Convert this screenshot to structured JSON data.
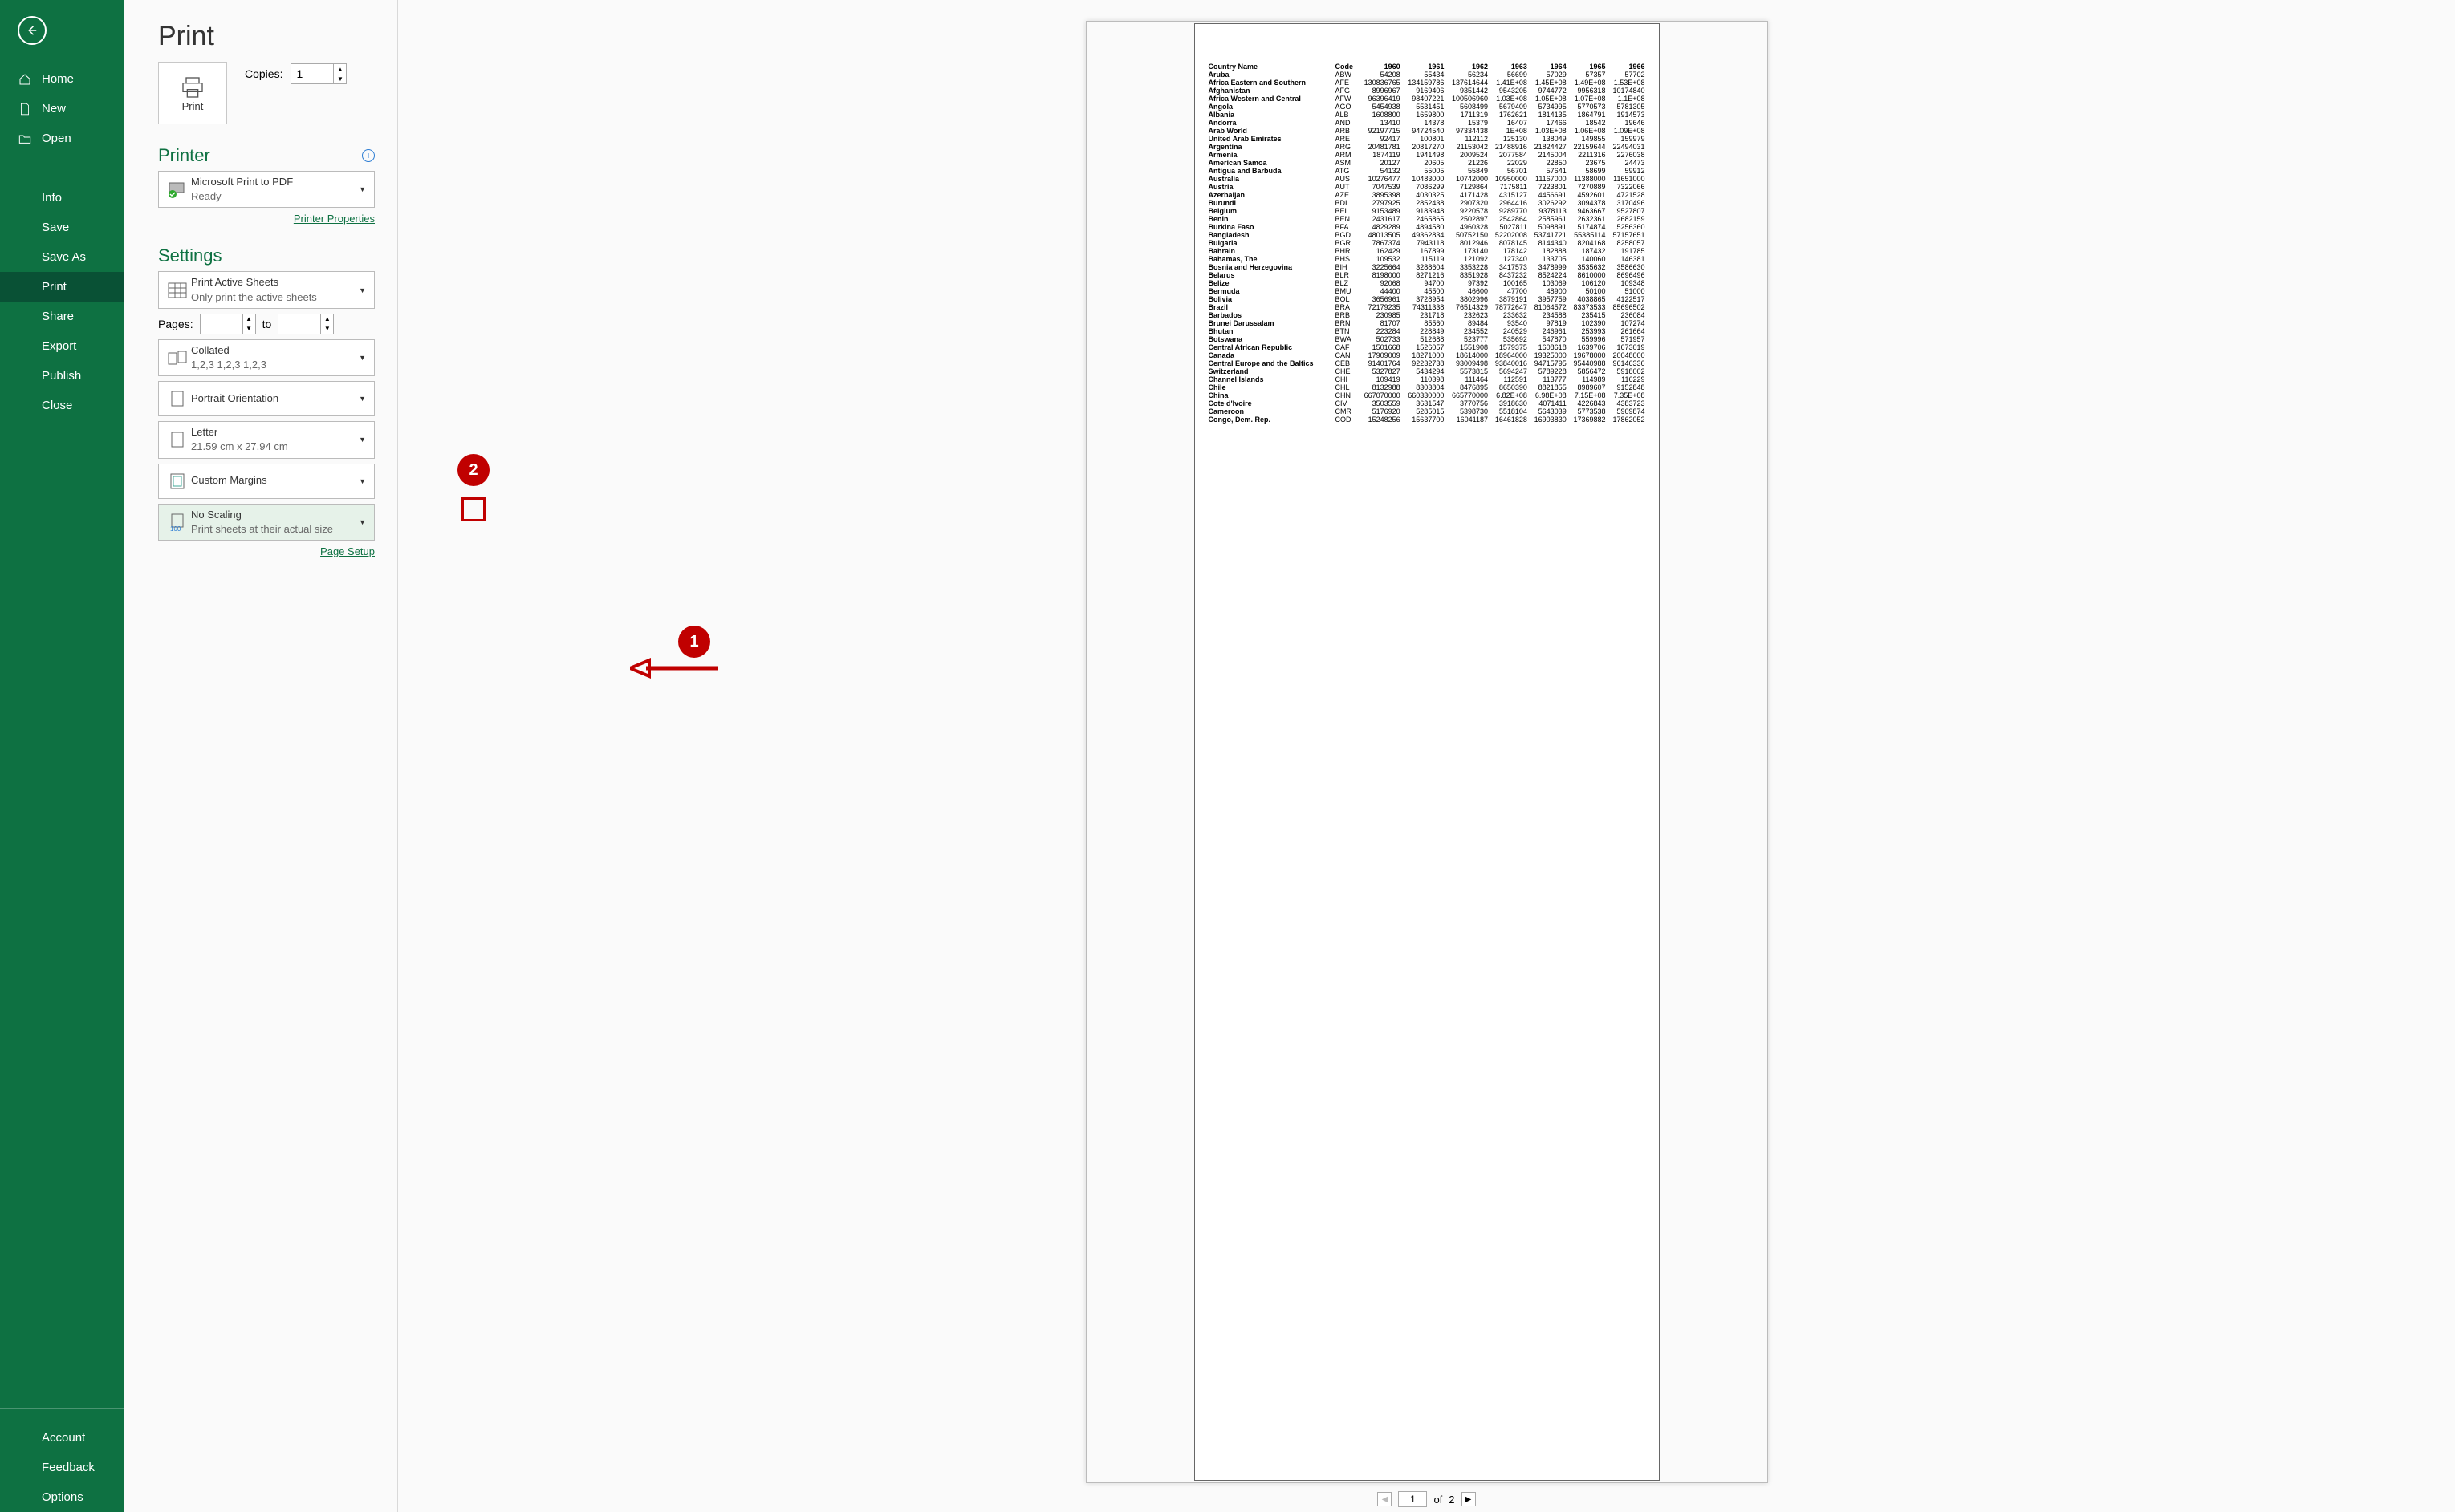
{
  "title": "Print",
  "nav": {
    "home": "Home",
    "new": "New",
    "open": "Open",
    "info": "Info",
    "save": "Save",
    "saveas": "Save As",
    "print": "Print",
    "share": "Share",
    "export": "Export",
    "publish": "Publish",
    "close": "Close",
    "account": "Account",
    "feedback": "Feedback",
    "options": "Options"
  },
  "print_btn": "Print",
  "copies": {
    "label": "Copies:",
    "value": "1"
  },
  "printer": {
    "heading": "Printer",
    "name": "Microsoft Print to PDF",
    "status": "Ready",
    "props_link": "Printer Properties"
  },
  "settings": {
    "heading": "Settings",
    "active": {
      "t": "Print Active Sheets",
      "s": "Only print the active sheets"
    },
    "pages": {
      "label": "Pages:",
      "to": "to"
    },
    "collate": {
      "t": "Collated",
      "s": "1,2,3    1,2,3    1,2,3"
    },
    "orient": {
      "t": "Portrait Orientation"
    },
    "paper": {
      "t": "Letter",
      "s": "21.59 cm x 27.94 cm"
    },
    "margins": {
      "t": "Custom Margins"
    },
    "scaling": {
      "t": "No Scaling",
      "s": "Print sheets at their actual size"
    },
    "page_setup": "Page Setup"
  },
  "pager": {
    "current": "1",
    "of": "of",
    "total": "2"
  },
  "table": {
    "headers": [
      "Country Name",
      "Code",
      "1960",
      "1961",
      "1962",
      "1963",
      "1964",
      "1965",
      "1966"
    ],
    "rows": [
      [
        "Aruba",
        "ABW",
        "54208",
        "55434",
        "56234",
        "56699",
        "57029",
        "57357",
        "57702"
      ],
      [
        "Africa Eastern and Southern",
        "AFE",
        "130836765",
        "134159786",
        "137614644",
        "1.41E+08",
        "1.45E+08",
        "1.49E+08",
        "1.53E+08"
      ],
      [
        "Afghanistan",
        "AFG",
        "8996967",
        "9169406",
        "9351442",
        "9543205",
        "9744772",
        "9956318",
        "10174840"
      ],
      [
        "Africa Western and Central",
        "AFW",
        "96396419",
        "98407221",
        "100506960",
        "1.03E+08",
        "1.05E+08",
        "1.07E+08",
        "1.1E+08"
      ],
      [
        "Angola",
        "AGO",
        "5454938",
        "5531451",
        "5608499",
        "5679409",
        "5734995",
        "5770573",
        "5781305"
      ],
      [
        "Albania",
        "ALB",
        "1608800",
        "1659800",
        "1711319",
        "1762621",
        "1814135",
        "1864791",
        "1914573"
      ],
      [
        "Andorra",
        "AND",
        "13410",
        "14378",
        "15379",
        "16407",
        "17466",
        "18542",
        "19646"
      ],
      [
        "Arab World",
        "ARB",
        "92197715",
        "94724540",
        "97334438",
        "1E+08",
        "1.03E+08",
        "1.06E+08",
        "1.09E+08"
      ],
      [
        "United Arab Emirates",
        "ARE",
        "92417",
        "100801",
        "112112",
        "125130",
        "138049",
        "149855",
        "159979"
      ],
      [
        "Argentina",
        "ARG",
        "20481781",
        "20817270",
        "21153042",
        "21488916",
        "21824427",
        "22159644",
        "22494031"
      ],
      [
        "Armenia",
        "ARM",
        "1874119",
        "1941498",
        "2009524",
        "2077584",
        "2145004",
        "2211316",
        "2276038"
      ],
      [
        "American Samoa",
        "ASM",
        "20127",
        "20605",
        "21226",
        "22029",
        "22850",
        "23675",
        "24473"
      ],
      [
        "Antigua and Barbuda",
        "ATG",
        "54132",
        "55005",
        "55849",
        "56701",
        "57641",
        "58699",
        "59912"
      ],
      [
        "Australia",
        "AUS",
        "10276477",
        "10483000",
        "10742000",
        "10950000",
        "11167000",
        "11388000",
        "11651000"
      ],
      [
        "Austria",
        "AUT",
        "7047539",
        "7086299",
        "7129864",
        "7175811",
        "7223801",
        "7270889",
        "7322066"
      ],
      [
        "Azerbaijan",
        "AZE",
        "3895398",
        "4030325",
        "4171428",
        "4315127",
        "4456691",
        "4592601",
        "4721528"
      ],
      [
        "Burundi",
        "BDI",
        "2797925",
        "2852438",
        "2907320",
        "2964416",
        "3026292",
        "3094378",
        "3170496"
      ],
      [
        "Belgium",
        "BEL",
        "9153489",
        "9183948",
        "9220578",
        "9289770",
        "9378113",
        "9463667",
        "9527807"
      ],
      [
        "Benin",
        "BEN",
        "2431617",
        "2465865",
        "2502897",
        "2542864",
        "2585961",
        "2632361",
        "2682159"
      ],
      [
        "Burkina Faso",
        "BFA",
        "4829289",
        "4894580",
        "4960328",
        "5027811",
        "5098891",
        "5174874",
        "5256360"
      ],
      [
        "Bangladesh",
        "BGD",
        "48013505",
        "49362834",
        "50752150",
        "52202008",
        "53741721",
        "55385114",
        "57157651"
      ],
      [
        "Bulgaria",
        "BGR",
        "7867374",
        "7943118",
        "8012946",
        "8078145",
        "8144340",
        "8204168",
        "8258057"
      ],
      [
        "Bahrain",
        "BHR",
        "162429",
        "167899",
        "173140",
        "178142",
        "182888",
        "187432",
        "191785"
      ],
      [
        "Bahamas, The",
        "BHS",
        "109532",
        "115119",
        "121092",
        "127340",
        "133705",
        "140060",
        "146381"
      ],
      [
        "Bosnia and Herzegovina",
        "BIH",
        "3225664",
        "3288604",
        "3353228",
        "3417573",
        "3478999",
        "3535632",
        "3586630"
      ],
      [
        "Belarus",
        "BLR",
        "8198000",
        "8271216",
        "8351928",
        "8437232",
        "8524224",
        "8610000",
        "8696496"
      ],
      [
        "Belize",
        "BLZ",
        "92068",
        "94700",
        "97392",
        "100165",
        "103069",
        "106120",
        "109348"
      ],
      [
        "Bermuda",
        "BMU",
        "44400",
        "45500",
        "46600",
        "47700",
        "48900",
        "50100",
        "51000"
      ],
      [
        "Bolivia",
        "BOL",
        "3656961",
        "3728954",
        "3802996",
        "3879191",
        "3957759",
        "4038865",
        "4122517"
      ],
      [
        "Brazil",
        "BRA",
        "72179235",
        "74311338",
        "76514329",
        "78772647",
        "81064572",
        "83373533",
        "85696502"
      ],
      [
        "Barbados",
        "BRB",
        "230985",
        "231718",
        "232623",
        "233632",
        "234588",
        "235415",
        "236084"
      ],
      [
        "Brunei Darussalam",
        "BRN",
        "81707",
        "85560",
        "89484",
        "93540",
        "97819",
        "102390",
        "107274"
      ],
      [
        "Bhutan",
        "BTN",
        "223284",
        "228849",
        "234552",
        "240529",
        "246961",
        "253993",
        "261664"
      ],
      [
        "Botswana",
        "BWA",
        "502733",
        "512688",
        "523777",
        "535692",
        "547870",
        "559996",
        "571957"
      ],
      [
        "Central African Republic",
        "CAF",
        "1501668",
        "1526057",
        "1551908",
        "1579375",
        "1608618",
        "1639706",
        "1673019"
      ],
      [
        "Canada",
        "CAN",
        "17909009",
        "18271000",
        "18614000",
        "18964000",
        "19325000",
        "19678000",
        "20048000"
      ],
      [
        "Central Europe and the Baltics",
        "CEB",
        "91401764",
        "92232738",
        "93009498",
        "93840016",
        "94715795",
        "95440988",
        "96146336"
      ],
      [
        "Switzerland",
        "CHE",
        "5327827",
        "5434294",
        "5573815",
        "5694247",
        "5789228",
        "5856472",
        "5918002"
      ],
      [
        "Channel Islands",
        "CHI",
        "109419",
        "110398",
        "111464",
        "112591",
        "113777",
        "114989",
        "116229"
      ],
      [
        "Chile",
        "CHL",
        "8132988",
        "8303804",
        "8476895",
        "8650390",
        "8821855",
        "8989607",
        "9152848"
      ],
      [
        "China",
        "CHN",
        "667070000",
        "660330000",
        "665770000",
        "6.82E+08",
        "6.98E+08",
        "7.15E+08",
        "7.35E+08"
      ],
      [
        "Cote d'Ivoire",
        "CIV",
        "3503559",
        "3631547",
        "3770756",
        "3918630",
        "4071411",
        "4226843",
        "4383723"
      ],
      [
        "Cameroon",
        "CMR",
        "5176920",
        "5285015",
        "5398730",
        "5518104",
        "5643039",
        "5773538",
        "5909874"
      ],
      [
        "Congo, Dem. Rep.",
        "COD",
        "15248256",
        "15637700",
        "16041187",
        "16461828",
        "16903830",
        "17369882",
        "17862052"
      ]
    ]
  },
  "anno": {
    "badge1": "1",
    "badge2": "2"
  }
}
